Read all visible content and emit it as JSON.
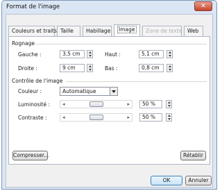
{
  "window": {
    "title": "Format de l'image",
    "close_glyph": "✕"
  },
  "tabs": [
    {
      "label": "Couleurs et traits",
      "state": "normal"
    },
    {
      "label": "Taille",
      "state": "normal"
    },
    {
      "label": "Habillage",
      "state": "normal"
    },
    {
      "label": "Image",
      "state": "active"
    },
    {
      "label": "Zone de texte",
      "state": "disabled"
    },
    {
      "label": "Web",
      "state": "normal"
    }
  ],
  "crop": {
    "heading": "Rognage",
    "left": {
      "label": "Gauche :",
      "value": "3,5 cm"
    },
    "top": {
      "label": "Haut :",
      "value": "5,1 cm"
    },
    "right": {
      "label": "Droite :",
      "value": "9 cm"
    },
    "bottom": {
      "label": "Bas :",
      "value": "0,8 cm"
    }
  },
  "image_control": {
    "heading": "Contrôle de l'image",
    "color": {
      "label": "Couleur :",
      "value": "Automatique"
    },
    "brightness": {
      "label": "Luminosité :",
      "value": "50 %",
      "level": 0.5
    },
    "contrast": {
      "label": "Contraste :",
      "value": "50 %",
      "level": 0.5
    }
  },
  "buttons": {
    "compress": "Compresser...",
    "reset": "Rétablir",
    "ok": "OK",
    "cancel": "Annuler"
  },
  "colors": {
    "frame": "#dbe6f4",
    "close": "#c4442c",
    "default_button": "#c9e4f8"
  }
}
